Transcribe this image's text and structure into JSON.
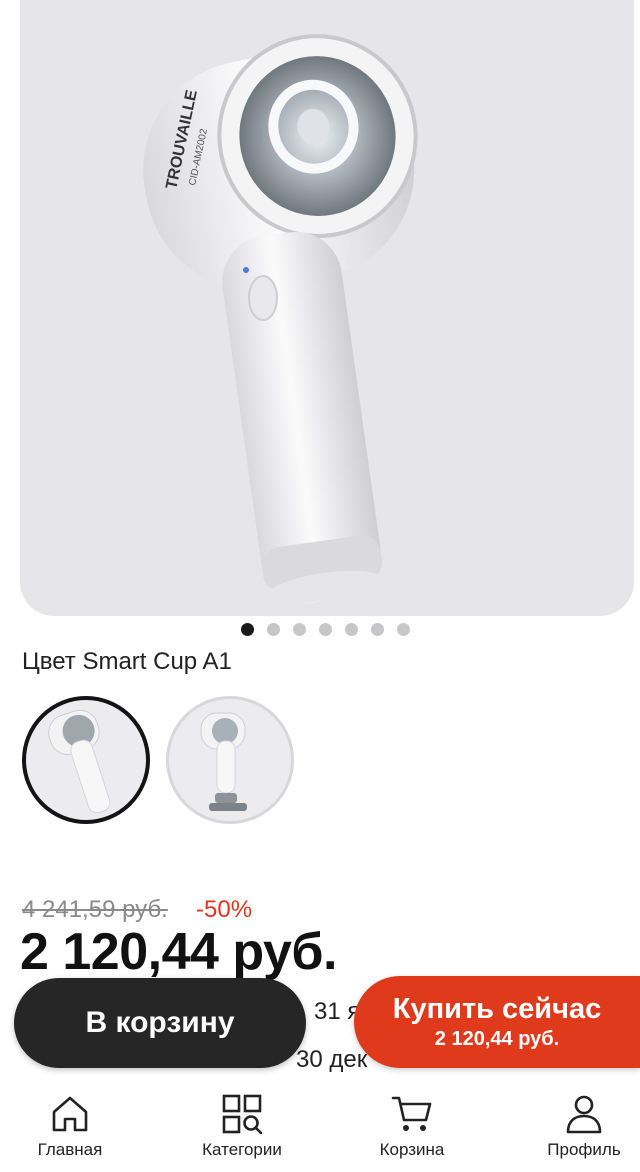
{
  "product": {
    "image_label": "Smart Cup A1 product photo",
    "brand_text": "TROUVAILLE",
    "model_text": "CID-AM2002",
    "gallery_count": 7,
    "gallery_active_index": 0
  },
  "variant": {
    "label": "Цвет Smart Cup A1",
    "options": [
      {
        "name": "Smart Cup A1",
        "selected": true
      },
      {
        "name": "variant-2",
        "selected": false
      }
    ]
  },
  "pricing": {
    "old_price": "4 241,59 руб.",
    "discount": "-50%",
    "price": "2 120,44 руб."
  },
  "delivery": {
    "line1_partial": "31 я",
    "line2_partial": "30 дек"
  },
  "actions": {
    "add_to_cart": "В корзину",
    "buy_now": "Купить сейчас",
    "buy_now_price": "2 120,44 руб."
  },
  "tabbar": {
    "home": "Главная",
    "categories": "Категории",
    "cart": "Корзина",
    "profile": "Профиль"
  },
  "colors": {
    "accent": "#e03a1c",
    "dark_button": "#262626",
    "discount": "#e0341e"
  }
}
